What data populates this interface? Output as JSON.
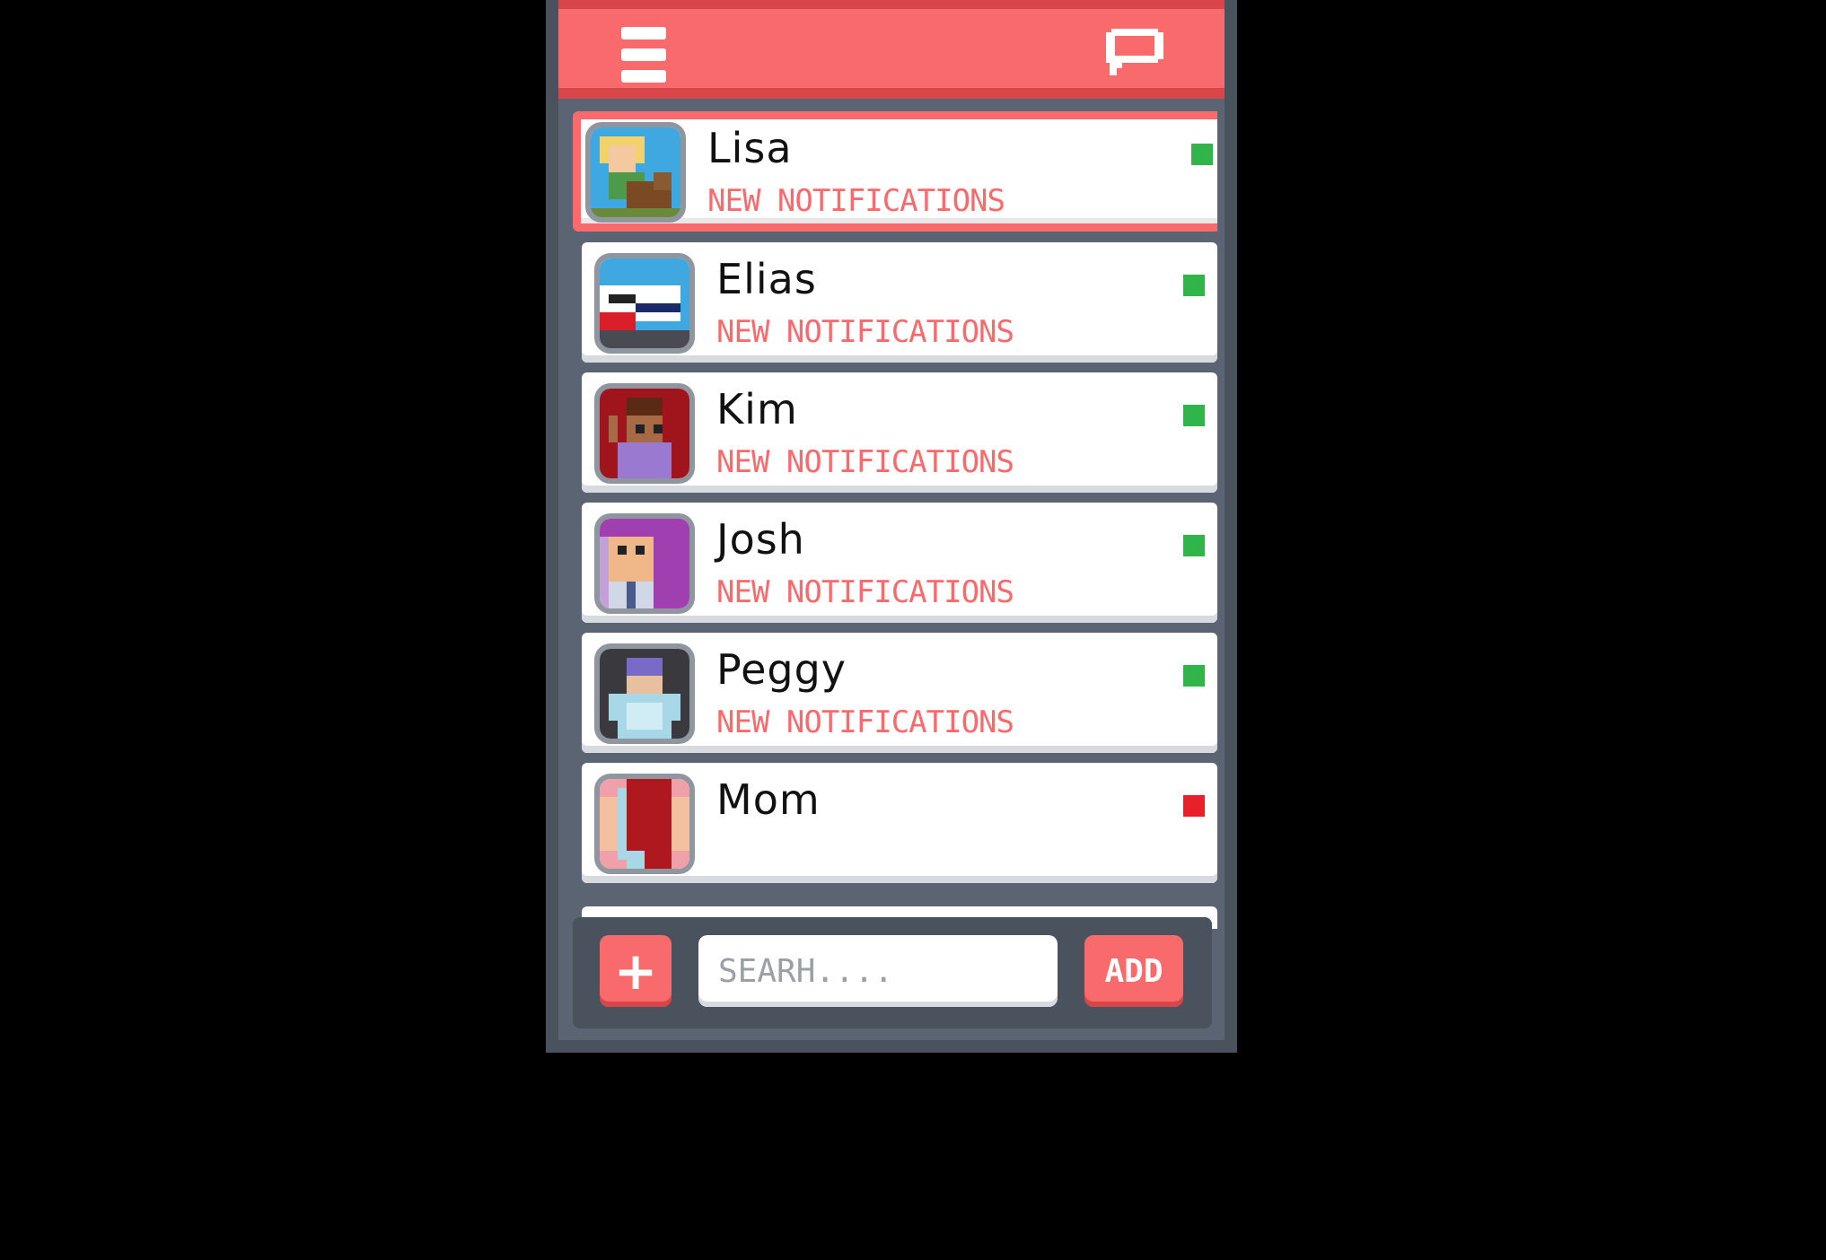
{
  "header": {
    "menu_icon": "hamburger-menu-icon",
    "chat_icon": "chat-bubble-icon"
  },
  "colors": {
    "accent": "#f96a6c",
    "online": "#2fb54a",
    "offline": "#e8202a",
    "panel": "#5b6472"
  },
  "contacts": [
    {
      "name": "Lisa",
      "notification": "NEW NOTIFICATIONS",
      "status": "online",
      "selected": true
    },
    {
      "name": "Elias",
      "notification": "NEW NOTIFICATIONS",
      "status": "online",
      "selected": false
    },
    {
      "name": "Kim",
      "notification": "NEW NOTIFICATIONS",
      "status": "online",
      "selected": false
    },
    {
      "name": "Josh",
      "notification": "NEW NOTIFICATIONS",
      "status": "online",
      "selected": false
    },
    {
      "name": "Peggy",
      "notification": "NEW NOTIFICATIONS",
      "status": "online",
      "selected": false
    },
    {
      "name": "Mom",
      "notification": "",
      "status": "offline",
      "selected": false
    }
  ],
  "footer": {
    "plus_label": "+",
    "search_placeholder": "SEARH....",
    "add_label": "ADD"
  }
}
